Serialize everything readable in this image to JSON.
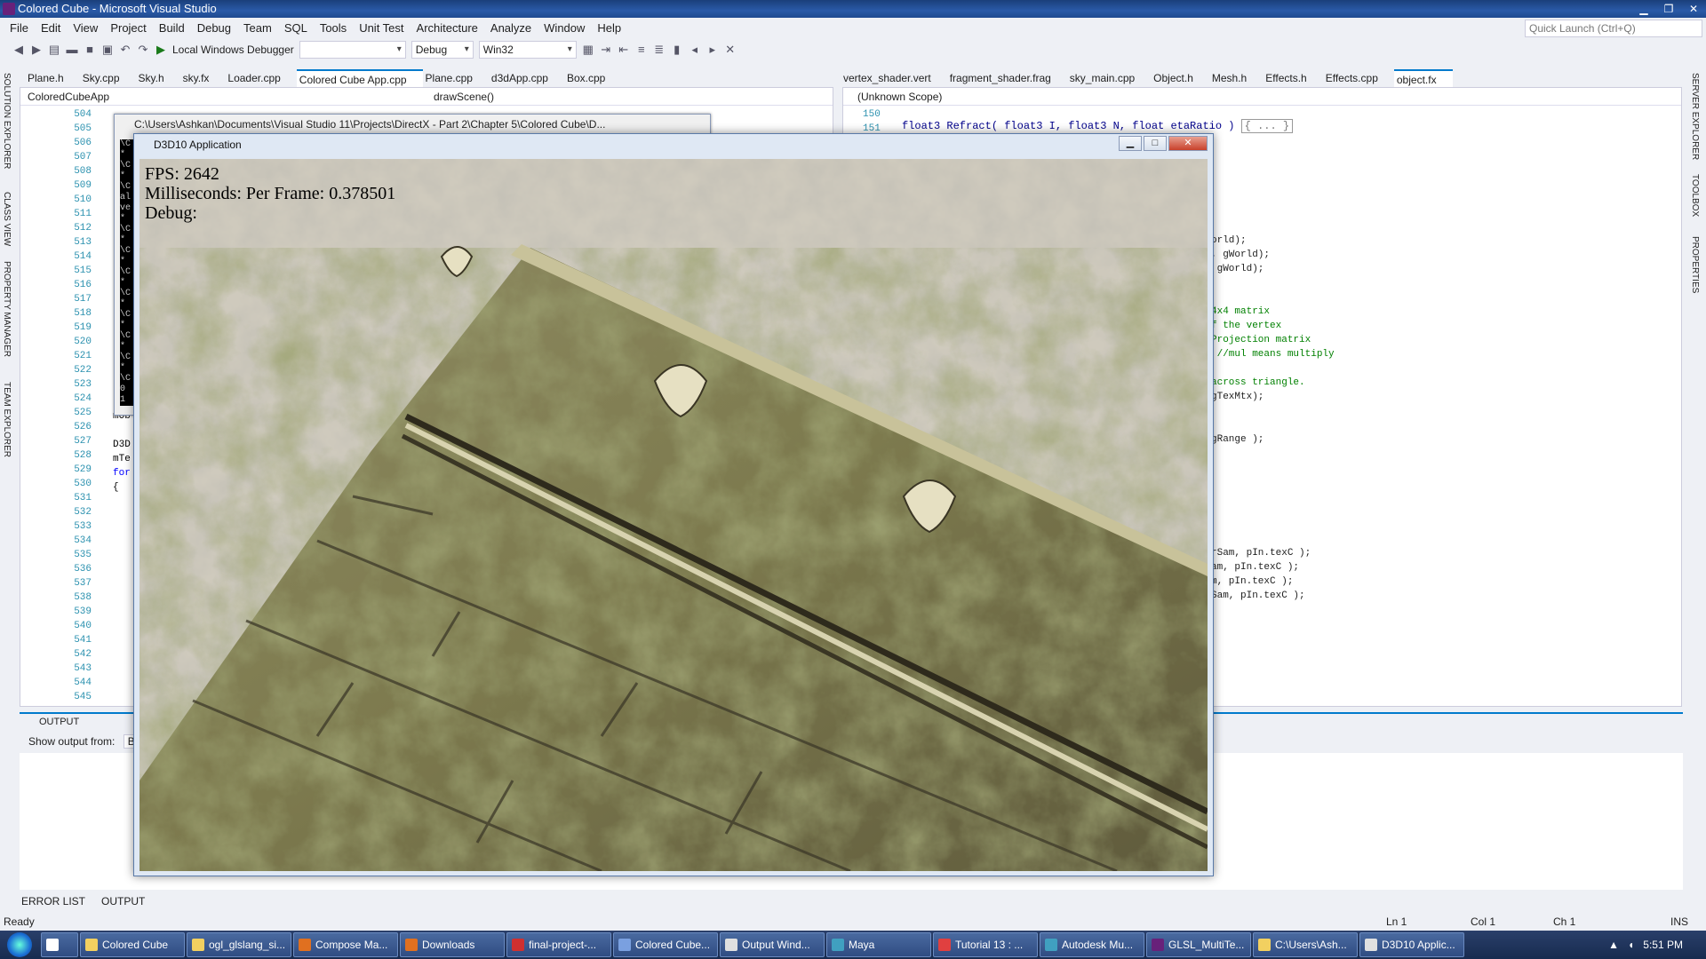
{
  "window": {
    "title": "Colored Cube - Microsoft Visual Studio"
  },
  "menu": [
    "File",
    "Edit",
    "View",
    "Project",
    "Build",
    "Debug",
    "Team",
    "SQL",
    "Tools",
    "Unit Test",
    "Architecture",
    "Analyze",
    "Window",
    "Help"
  ],
  "quick_launch": {
    "placeholder": "Quick Launch (Ctrl+Q)"
  },
  "toolbar": {
    "debugger": "Local Windows Debugger",
    "config": "Debug",
    "platform": "Win32"
  },
  "tabs_left": [
    {
      "label": "Plane.h"
    },
    {
      "label": "Sky.cpp"
    },
    {
      "label": "Sky.h"
    },
    {
      "label": "sky.fx"
    },
    {
      "label": "Loader.cpp"
    },
    {
      "label": "Colored Cube App.cpp",
      "active": true
    },
    {
      "label": "Plane.cpp"
    },
    {
      "label": "d3dApp.cpp"
    },
    {
      "label": "Box.cpp"
    }
  ],
  "tabs_right": [
    {
      "label": "vertex_shader.vert"
    },
    {
      "label": "fragment_shader.frag"
    },
    {
      "label": "sky_main.cpp"
    },
    {
      "label": "Object.h"
    },
    {
      "label": "Mesh.h"
    },
    {
      "label": "Effects.h"
    },
    {
      "label": "Effects.cpp"
    },
    {
      "label": "object.fx",
      "active": true
    }
  ],
  "side_left": [
    "SOLUTION EXPLORER",
    "CLASS VIEW",
    "PROPERTY MANAGER",
    "TEAM EXPLORER"
  ],
  "side_right": [
    "SERVER EXPLORER",
    "TOOLBOX",
    "PROPERTIES"
  ],
  "editor_left": {
    "nav_class": "ColoredCubeApp",
    "nav_member": "drawScene()",
    "line_numbers": [
      "504",
      "505",
      "506",
      "507",
      "508",
      "509",
      "510",
      "511",
      "512",
      "513",
      "514",
      "515",
      "516",
      "517",
      "518",
      "519",
      "520",
      "521",
      "522",
      "523",
      "524",
      "525",
      "526",
      "527",
      "528",
      "529",
      "530",
      "531",
      "532",
      "533",
      "534",
      "535",
      "536",
      "537",
      "538",
      "539",
      "540",
      "541",
      "542",
      "543",
      "544",
      "545"
    ],
    "code": [
      "mOb",
      "",
      "D3D",
      "mTe",
      "for",
      "{"
    ]
  },
  "editor_right": {
    "nav_scope": "(Unknown Scope)",
    "line_numbers": [
      "150",
      "151"
    ],
    "line_151": "float3 Refract( float3 I, float3 N, float etaRatio )",
    "collapsed": "{ ... }",
    "code": [
      {
        "text": "orld);",
        "comment": false
      },
      {
        "text": ", gWorld);",
        "comment": false
      },
      {
        "text": " gWorld);",
        "comment": false
      },
      {
        "text": "",
        "comment": false
      },
      {
        "text": "",
        "comment": false
      },
      {
        "text": "4x4 matrix",
        "comment": true
      },
      {
        "text": "f the vertex",
        "comment": true
      },
      {
        "text": "Projection matrix",
        "comment": true
      },
      {
        "text": " //mul means multiply",
        "comment": true
      },
      {
        "text": "",
        "comment": false
      },
      {
        "text": "across triangle.",
        "comment": true
      },
      {
        "text": "gTexMtx);",
        "comment": false
      },
      {
        "text": "",
        "comment": false
      },
      {
        "text": "",
        "comment": false
      },
      {
        "text": "gRange );",
        "comment": false
      },
      {
        "text": "",
        "comment": false
      },
      {
        "text": "",
        "comment": false
      },
      {
        "text": "",
        "comment": false
      },
      {
        "text": "",
        "comment": false
      },
      {
        "text": "",
        "comment": false
      },
      {
        "text": "",
        "comment": false
      },
      {
        "text": "",
        "comment": false
      },
      {
        "text": "rSam, pIn.texC );",
        "comment": false
      },
      {
        "text": "am, pIn.texC );",
        "comment": false
      },
      {
        "text": "m, pIn.texC );",
        "comment": false
      },
      {
        "text": "Sam, pIn.texC );",
        "comment": false
      }
    ]
  },
  "output": {
    "title": "OUTPUT",
    "show_from": "Show output from:",
    "source": "B"
  },
  "bottom_tabs": [
    "ERROR LIST",
    "OUTPUT"
  ],
  "status": {
    "ready": "Ready",
    "ln": "Ln 1",
    "col": "Col 1",
    "ch": "Ch 1",
    "ins": "INS"
  },
  "console": {
    "title": "C:\\Users\\Ashkan\\Documents\\Visual Studio 11\\Projects\\DirectX - Part 2\\Chapter 5\\Colored Cube\\D...",
    "chars": [
      "\\C",
      "*",
      "\\C",
      "*",
      "\\C",
      "al",
      "ve",
      "*",
      "\\C",
      "*",
      "\\C",
      "*",
      "\\C",
      "*",
      "\\C",
      "*",
      "\\C",
      "*",
      "\\C",
      "*",
      "\\C",
      "*",
      "\\C",
      "0",
      "1",
      "nu"
    ]
  },
  "d3d": {
    "title": "D3D10 Application",
    "fps": "FPS: 2642",
    "ms": "Milliseconds: Per Frame: 0.378501",
    "debug": "Debug:"
  },
  "taskbar": [
    {
      "label": "",
      "color": "#ffffff"
    },
    {
      "label": "Colored Cube",
      "color": "#f2d060"
    },
    {
      "label": "ogl_glslang_si...",
      "color": "#f2d060"
    },
    {
      "label": "Compose Ma...",
      "color": "#e07020"
    },
    {
      "label": "Downloads",
      "color": "#e07020"
    },
    {
      "label": "final-project-...",
      "color": "#d03030"
    },
    {
      "label": "Colored Cube...",
      "color": "#7aa0e0"
    },
    {
      "label": "Output Wind...",
      "color": "#e0e0e0"
    },
    {
      "label": "Maya",
      "color": "#40a0c0"
    },
    {
      "label": "Tutorial 13 : ...",
      "color": "#e04040"
    },
    {
      "label": "Autodesk Mu...",
      "color": "#40a0c0"
    },
    {
      "label": "GLSL_MultiTe...",
      "color": "#68217a"
    },
    {
      "label": "C:\\Users\\Ash...",
      "color": "#f2d060"
    },
    {
      "label": "D3D10 Applic...",
      "color": "#e0e0e0"
    }
  ],
  "clock": "5:51 PM"
}
